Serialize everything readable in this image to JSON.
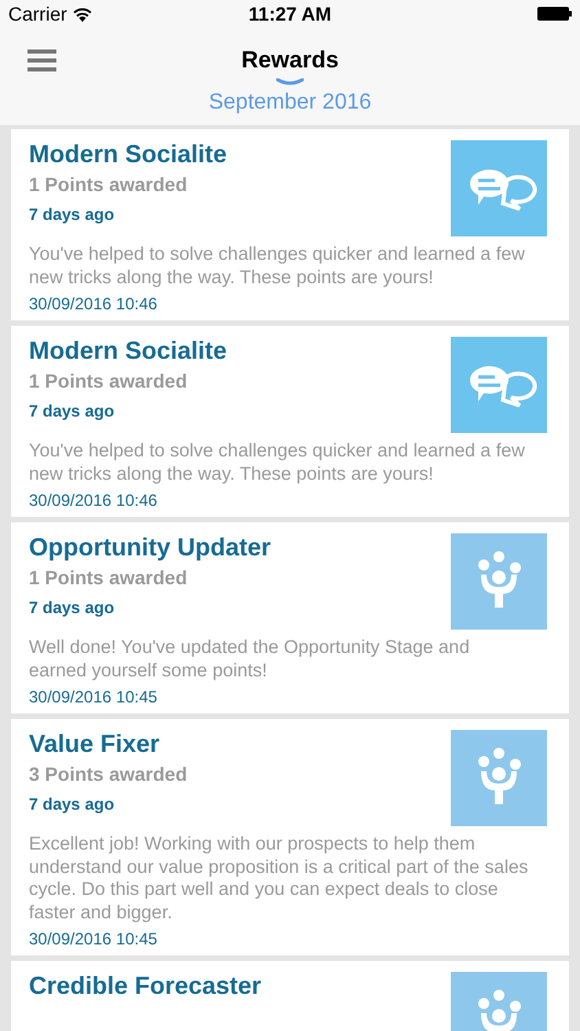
{
  "status_bar": {
    "carrier": "Carrier",
    "time": "11:27 AM"
  },
  "nav": {
    "title": "Rewards",
    "month": "September 2016"
  },
  "rewards": [
    {
      "title": "Modern Socialite",
      "points": "1 Points awarded",
      "ago": "7 days ago",
      "description": "You've helped to solve challenges quicker and learned a few new tricks along the way. These points are yours!",
      "date": "30/09/2016 10:46",
      "kind": "chat"
    },
    {
      "title": "Modern Socialite",
      "points": "1 Points awarded",
      "ago": "7 days ago",
      "description": "You've helped to solve challenges quicker and learned a few new tricks along the way. These points are yours!",
      "date": "30/09/2016 10:46",
      "kind": "chat"
    },
    {
      "title": "Opportunity Updater",
      "points": "1 Points awarded",
      "ago": "7 days ago",
      "description": "Well done! You've updated the Opportunity Stage and earned yourself some points!",
      "date": "30/09/2016 10:45",
      "kind": "person"
    },
    {
      "title": "Value Fixer",
      "points": "3 Points awarded",
      "ago": "7 days ago",
      "description": "Excellent job! Working with our prospects to help them understand our value proposition is a critical part of the sales cycle. Do this part well and you can expect deals to close faster and bigger.",
      "date": "30/09/2016 10:45",
      "kind": "person"
    },
    {
      "title": "Credible Forecaster",
      "kind": "person"
    }
  ]
}
